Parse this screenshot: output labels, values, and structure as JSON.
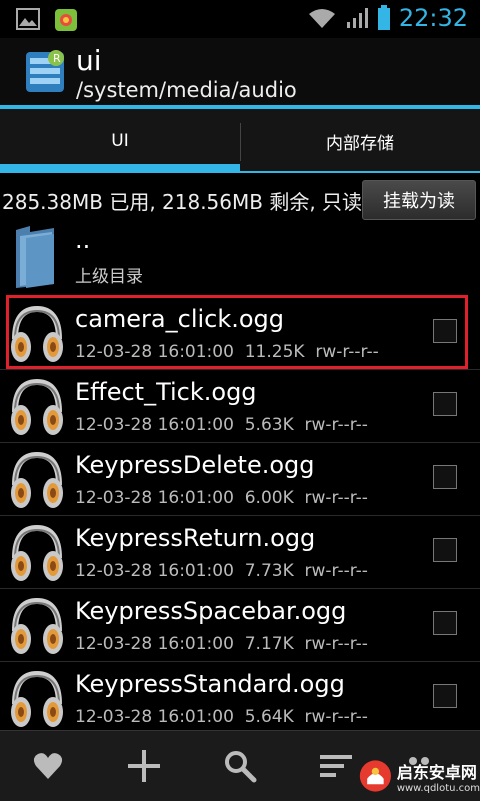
{
  "status_bar": {
    "time": "22:32"
  },
  "header": {
    "title": "ui",
    "path": "/system/media/audio"
  },
  "tabs": [
    {
      "label": "UI"
    },
    {
      "label": "内部存储"
    }
  ],
  "storage": {
    "info": "285.38MB 已用, 218.56MB 剩余, 只读",
    "mount_label": "挂载为读"
  },
  "parent": {
    "name": "..",
    "label": "上级目录"
  },
  "files": [
    {
      "name": "camera_click.ogg",
      "meta": "12-03-28 16:01:00  11.25K  rw-r--r--"
    },
    {
      "name": "Effect_Tick.ogg",
      "meta": "12-03-28 16:01:00  5.63K  rw-r--r--"
    },
    {
      "name": "KeypressDelete.ogg",
      "meta": "12-03-28 16:01:00  6.00K  rw-r--r--"
    },
    {
      "name": "KeypressReturn.ogg",
      "meta": "12-03-28 16:01:00  7.73K  rw-r--r--"
    },
    {
      "name": "KeypressSpacebar.ogg",
      "meta": "12-03-28 16:01:00  7.17K  rw-r--r--"
    },
    {
      "name": "KeypressStandard.ogg",
      "meta": "12-03-28 16:01:00  5.64K  rw-r--r--"
    }
  ],
  "toolbar": {
    "icons": [
      "heart-icon",
      "plus-icon",
      "search-icon",
      "sort-icon",
      "more-icon"
    ]
  },
  "watermark": {
    "line1": "启东安卓网",
    "line2": "www.qdlotu.com"
  },
  "colors": {
    "accent": "#33b5e5",
    "highlight": "#e0202a"
  }
}
